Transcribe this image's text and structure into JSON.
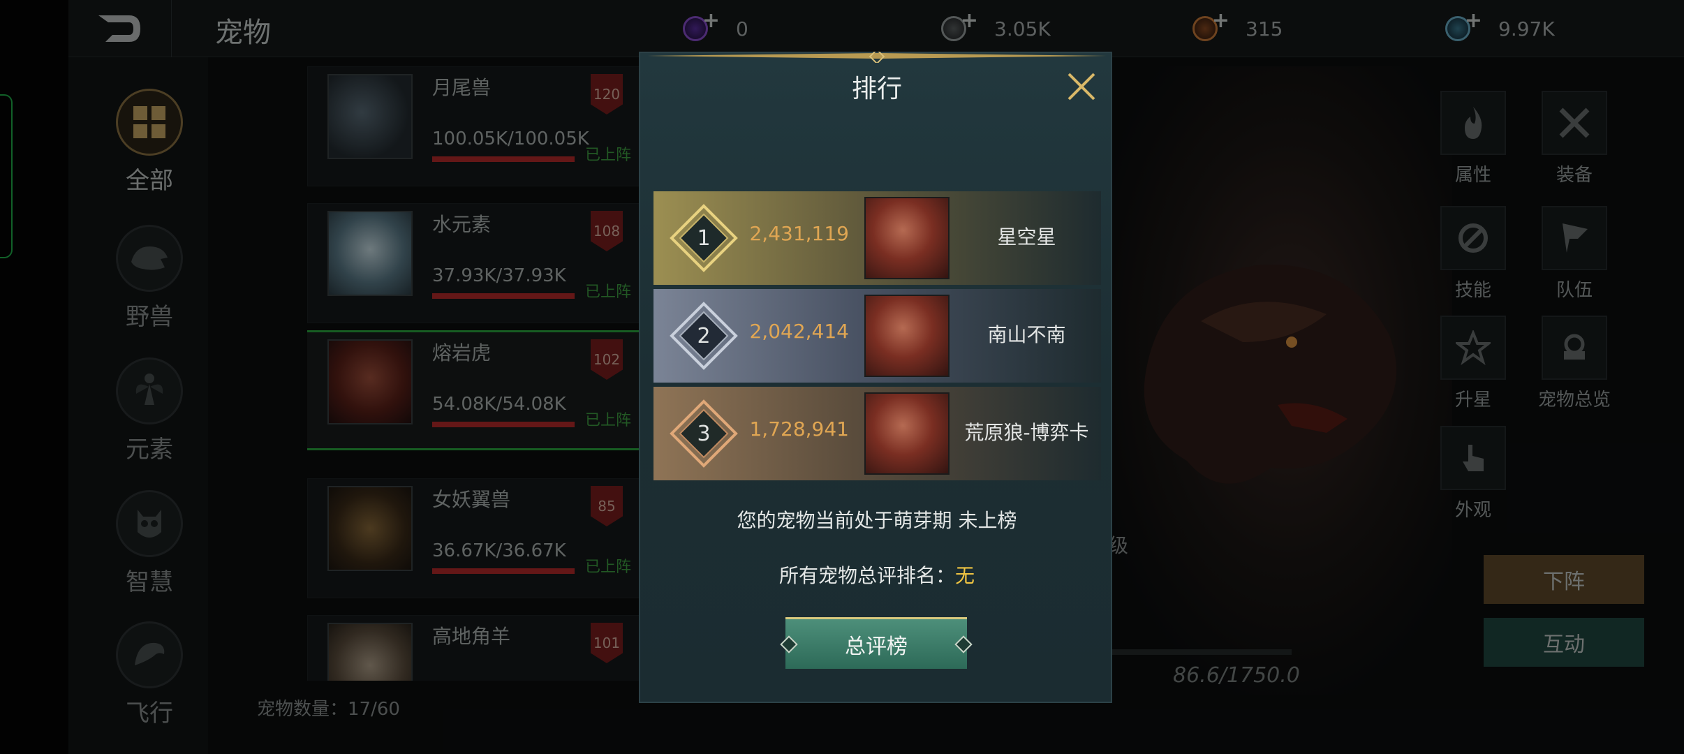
{
  "topbar": {
    "title": "宠物",
    "currencies": [
      {
        "icon": "purple-gem-icon",
        "value": "0",
        "color": "#8a4fd0"
      },
      {
        "icon": "silver-coin-icon",
        "value": "3.05K",
        "color": "#9aa0a0"
      },
      {
        "icon": "bronze-coin-icon",
        "value": "315",
        "color": "#c97a3a"
      },
      {
        "icon": "crystal-orb-icon",
        "value": "9.97K",
        "color": "#6ab0c8"
      }
    ]
  },
  "categories": [
    {
      "label": "全部",
      "icon": "grid-icon",
      "active": true
    },
    {
      "label": "野兽",
      "icon": "beast-icon"
    },
    {
      "label": "元素",
      "icon": "fairy-icon"
    },
    {
      "label": "智慧",
      "icon": "owl-icon"
    },
    {
      "label": "飞行",
      "icon": "bird-icon"
    }
  ],
  "pets": [
    {
      "name": "月尾兽",
      "hp": "100.05K/100.05K",
      "level": "120",
      "status": "已上阵"
    },
    {
      "name": "水元素",
      "hp": "37.93K/37.93K",
      "level": "108",
      "status": "已上阵"
    },
    {
      "name": "熔岩虎",
      "hp": "54.08K/54.08K",
      "level": "102",
      "status": "已上阵"
    },
    {
      "name": "女妖翼兽",
      "hp": "36.67K/36.67K",
      "level": "85",
      "status": "已上阵"
    },
    {
      "name": "高地角羊",
      "hp": "",
      "level": "101",
      "status": ""
    }
  ],
  "pet_count": "宠物数量：17/60",
  "hero": {
    "star_label": "星级",
    "exp": "86.6/1750.0"
  },
  "right_menu": [
    {
      "label": "属性",
      "icon": "flame-icon"
    },
    {
      "label": "装备",
      "icon": "swords-icon"
    },
    {
      "label": "技能",
      "icon": "skill-icon"
    },
    {
      "label": "队伍",
      "icon": "flag-icon"
    },
    {
      "label": "升星",
      "icon": "star-icon"
    },
    {
      "label": "宠物总览",
      "icon": "overview-icon"
    },
    {
      "label": "外观",
      "icon": "hand-icon"
    }
  ],
  "actions": {
    "down": "下阵",
    "interact": "互动"
  },
  "modal": {
    "title": "排行",
    "rankings": [
      {
        "rank": "1",
        "score": "2,431,119",
        "name": "星空星"
      },
      {
        "rank": "2",
        "score": "2,042,414",
        "name": "南山不南"
      },
      {
        "rank": "3",
        "score": "1,728,941",
        "name": "荒原狼-博弈卡"
      }
    ],
    "status_text": "您的宠物当前处于萌芽期  未上榜",
    "rank_label": "所有宠物总评排名：",
    "rank_value": "无",
    "button": "总评榜"
  },
  "colors": {
    "rank1": "#b8a55e",
    "rank2": "#8e97a6",
    "rank3": "#a8835c",
    "accent_gold": "#f0c542",
    "score_orange": "#e0a653"
  }
}
